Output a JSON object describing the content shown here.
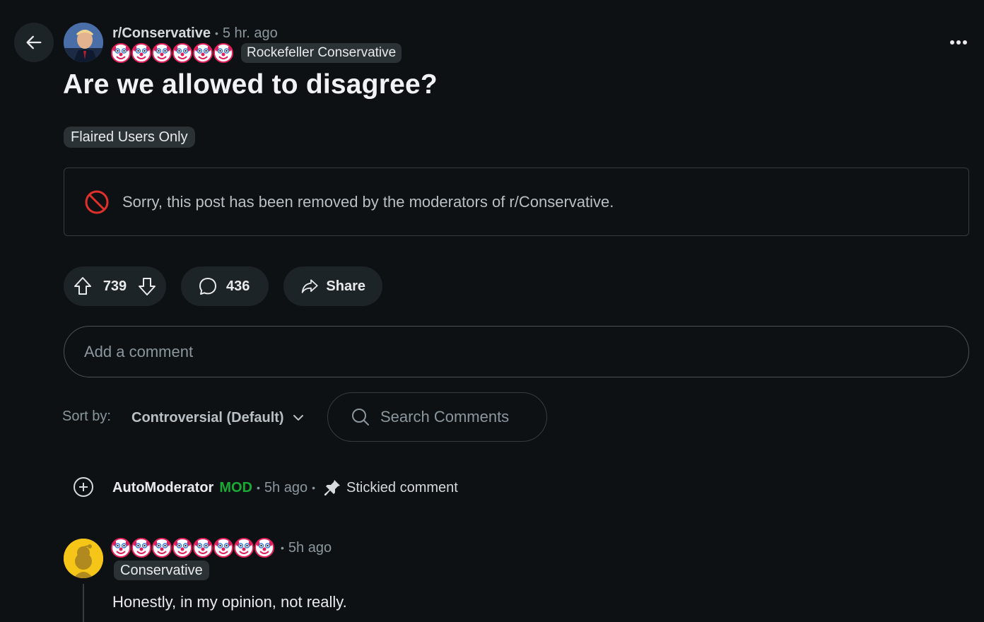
{
  "post": {
    "subreddit": "r/Conservative",
    "time": "5 hr. ago",
    "author_flair": "Rockefeller Conservative",
    "author_flair_emoji_count": 6,
    "title": "Are we allowed to disagree?",
    "post_flair": "Flaired Users Only",
    "removed_notice": "Sorry, this post has been removed by the moderators of r/Conservative."
  },
  "actions": {
    "score": "739",
    "comments": "436",
    "share_label": "Share"
  },
  "comment_box": {
    "placeholder": "Add a comment"
  },
  "sort": {
    "label": "Sort by:",
    "value": "Controversial (Default)"
  },
  "search": {
    "placeholder": "Search Comments"
  },
  "comments": [
    {
      "author": "AutoModerator",
      "mod_tag": "MOD",
      "time": "5h ago",
      "sticky_label": "Stickied comment"
    },
    {
      "author_emoji_count": 8,
      "time": "5h ago",
      "flair": "Conservative",
      "body": "Honestly, in my opinion, not really."
    }
  ],
  "colors": {
    "background": "#0e1113",
    "mod_green": "#1ba936",
    "removed_red": "#e0302c",
    "pill_bg": "#1d2428"
  },
  "icons": [
    "back-arrow-icon",
    "more-options-icon",
    "removed-icon",
    "upvote-icon",
    "downvote-icon",
    "comment-icon",
    "share-icon",
    "chevron-down-icon",
    "search-icon",
    "expand-plus-icon",
    "pin-icon",
    "clown-emoji-icon"
  ]
}
